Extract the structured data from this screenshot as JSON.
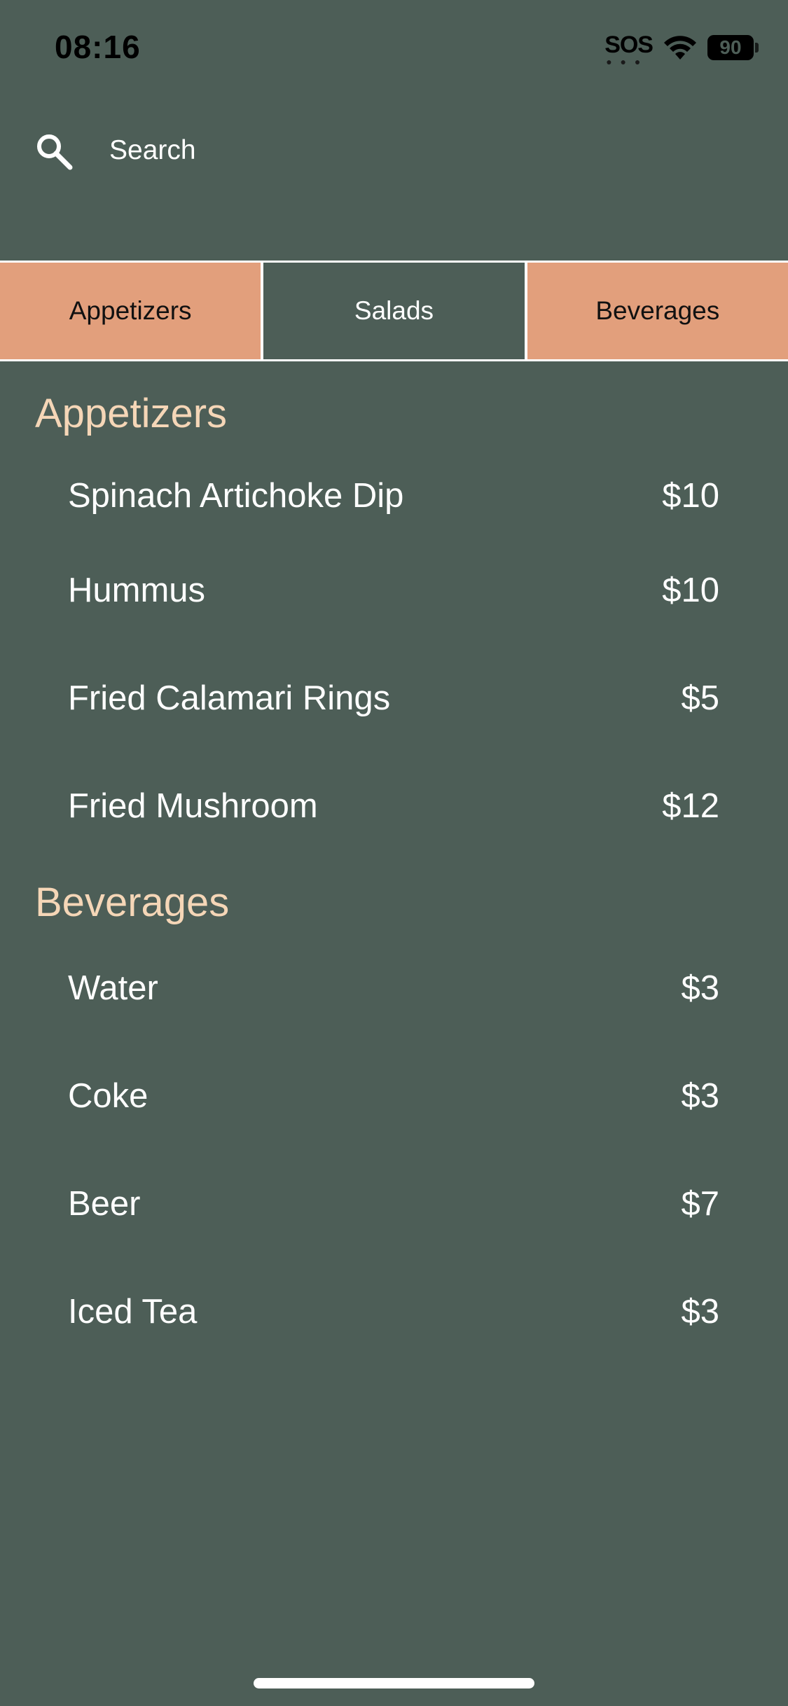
{
  "status_bar": {
    "time": "08:16",
    "sos": "SOS",
    "battery": "90"
  },
  "search": {
    "placeholder": "Search"
  },
  "tabs": [
    {
      "label": "Appetizers",
      "active": false
    },
    {
      "label": "Salads",
      "active": true
    },
    {
      "label": "Beverages",
      "active": false
    }
  ],
  "sections": [
    {
      "title": "Appetizers",
      "items": [
        {
          "name": "Spinach Artichoke Dip",
          "price": "$10"
        },
        {
          "name": "Hummus",
          "price": "$10"
        },
        {
          "name": "Fried Calamari Rings",
          "price": "$5"
        },
        {
          "name": "Fried Mushroom",
          "price": "$12"
        }
      ]
    },
    {
      "title": "Beverages",
      "items": [
        {
          "name": "Water",
          "price": "$3"
        },
        {
          "name": "Coke",
          "price": "$3"
        },
        {
          "name": "Beer",
          "price": "$7"
        },
        {
          "name": "Iced Tea",
          "price": "$3"
        }
      ]
    }
  ],
  "colors": {
    "background": "#4D5E57",
    "tab_inactive": "#E29F7C",
    "section_title": "#F5D6B7",
    "text": "#FFFFFF"
  },
  "icons": {
    "search": "search-icon",
    "wifi": "wifi-icon",
    "battery": "battery-icon"
  }
}
